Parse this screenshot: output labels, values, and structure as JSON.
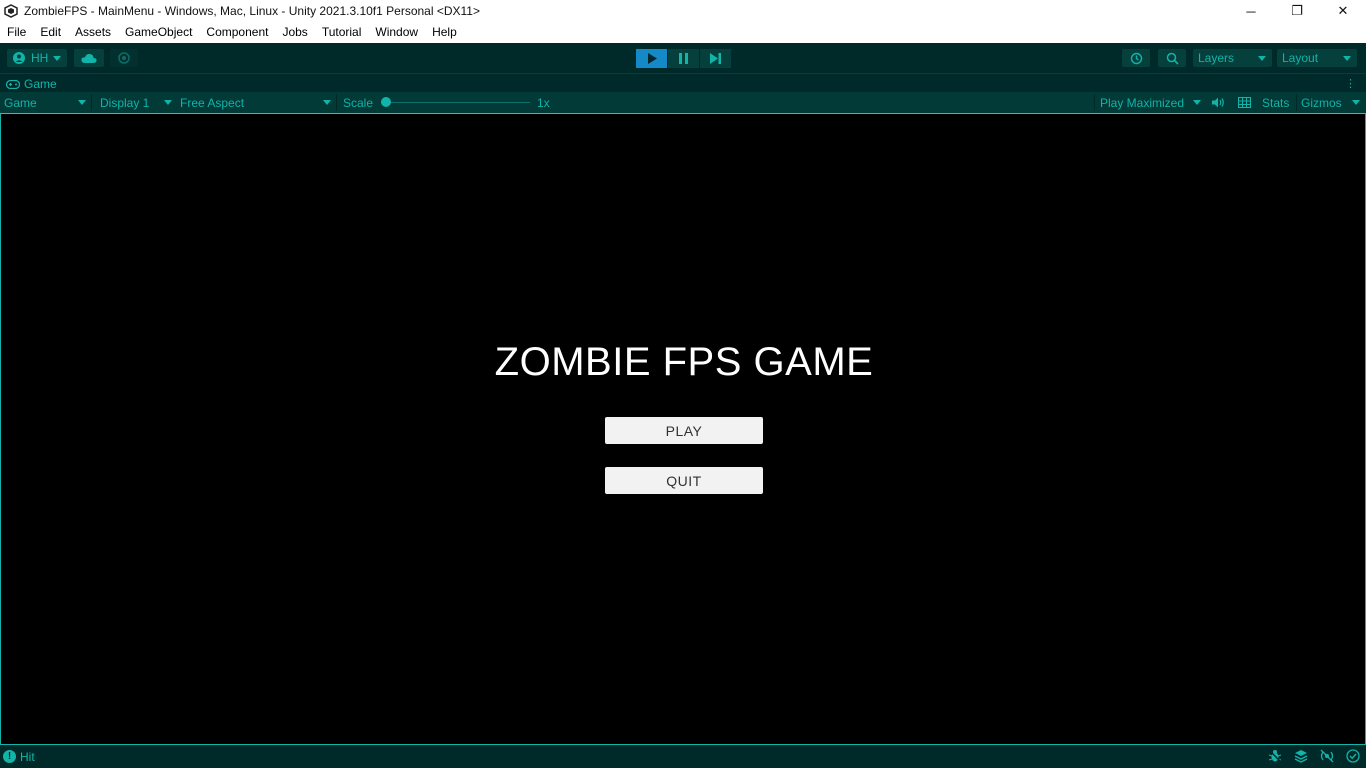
{
  "window": {
    "title": "ZombieFPS - MainMenu - Windows, Mac, Linux - Unity 2021.3.10f1 Personal <DX11>",
    "controls": {
      "minimize": "─",
      "restore": "❐",
      "close": "✕"
    }
  },
  "menubar": {
    "items": [
      "File",
      "Edit",
      "Assets",
      "GameObject",
      "Component",
      "Jobs",
      "Tutorial",
      "Window",
      "Help"
    ]
  },
  "toolbar": {
    "account_label": "HH",
    "layers_label": "Layers",
    "layout_label": "Layout",
    "play_state": "playing"
  },
  "tab": {
    "label": "Game"
  },
  "game_view": {
    "view_select": "Game",
    "display_select": "Display 1",
    "aspect_select": "Free Aspect",
    "scale_label": "Scale",
    "scale_value": "1x",
    "scale_level": 0,
    "play_mode_select": "Play Maximized",
    "stats_label": "Stats",
    "gizmos_label": "Gizmos"
  },
  "game": {
    "title": "ZOMBIE FPS GAME",
    "play_button": "PLAY",
    "quit_button": "QUIT"
  },
  "status": {
    "message": "Hit",
    "icon_left": "!"
  },
  "colors": {
    "accent": "#12b3a8",
    "toolbar_bg": "#002a29",
    "play_active": "#1589c7"
  },
  "icons": [
    "unity-logo-icon",
    "account-icon",
    "cloud-icon",
    "collab-icon",
    "play-icon",
    "pause-icon",
    "step-icon",
    "history-icon",
    "search-icon",
    "gamepad-icon",
    "kebab-menu-icon",
    "audio-icon",
    "grid-icon",
    "bug-icon",
    "layers-icon",
    "no-network-icon",
    "check-circle-icon"
  ]
}
